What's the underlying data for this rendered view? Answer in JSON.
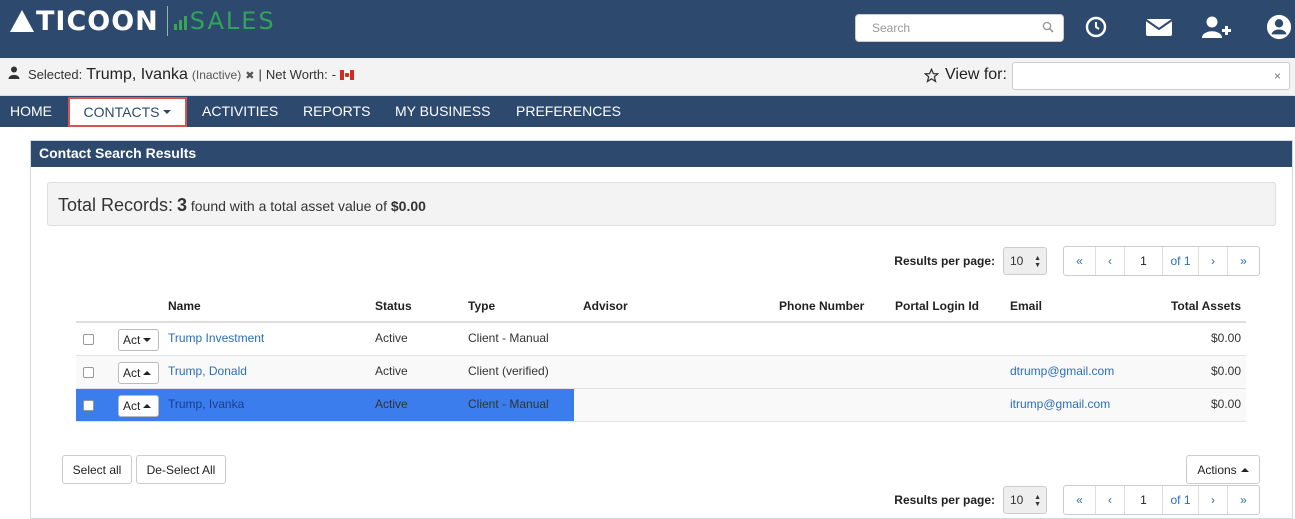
{
  "header": {
    "brand_primary": "TICOON",
    "brand_secondary": "SALES",
    "search_placeholder": "Search",
    "icons": [
      "search-icon",
      "history-icon",
      "mail-icon",
      "add-user-icon",
      "user-icon"
    ]
  },
  "selection": {
    "label": "Selected:",
    "name": "Trump, Ivanka",
    "status": "(Inactive)",
    "remove_glyph": "✖",
    "separator": "|",
    "net_worth_label": "Net Worth:",
    "net_worth_value": "-",
    "view_for_label": "View for:",
    "clear_glyph": "×"
  },
  "nav": {
    "items": [
      "HOME",
      "CONTACTS",
      "ACTIVITIES",
      "REPORTS",
      "MY BUSINESS",
      "PREFERENCES"
    ]
  },
  "panel": {
    "title": "Contact Search Results",
    "summary": {
      "label": "Total Records:",
      "count": "3",
      "middle": "found with a total asset value of",
      "value": "$0.00"
    }
  },
  "pagination": {
    "rpp_label": "Results per page:",
    "rpp_value": "10",
    "first": "«",
    "prev": "‹",
    "page": "1",
    "of": "of 1",
    "next": "›",
    "last": "»"
  },
  "table": {
    "columns": [
      "Name",
      "Status",
      "Type",
      "Advisor",
      "Phone Number",
      "Portal Login Id",
      "Email",
      "Total Assets"
    ],
    "rows": [
      {
        "action": "Act",
        "name": "Trump Investment",
        "status": "Active",
        "type": "Client - Manual",
        "advisor": "",
        "phone": "",
        "portal": "",
        "email": "",
        "assets": "$0.00"
      },
      {
        "action": "Act",
        "name": "Trump, Donald",
        "status": "Active",
        "type": "Client (verified)",
        "advisor": "",
        "phone": "",
        "portal": "",
        "email": "dtrump@gmail.com",
        "assets": "$0.00"
      },
      {
        "action": "Act",
        "name": "Trump, Ivanka",
        "status": "Active",
        "type": "Client - Manual",
        "advisor": "",
        "phone": "",
        "portal": "",
        "email": "itrump@gmail.com",
        "assets": "$0.00"
      }
    ]
  },
  "footer": {
    "select_all": "Select all",
    "deselect_all": "De-Select All",
    "actions": "Actions"
  },
  "colors": {
    "nav_bg": "#2d4a6e",
    "brand_green": "#2fa45a",
    "selected_row": "#3b7ded",
    "link": "#2a6ebb",
    "highlight_border": "#d9534f"
  }
}
